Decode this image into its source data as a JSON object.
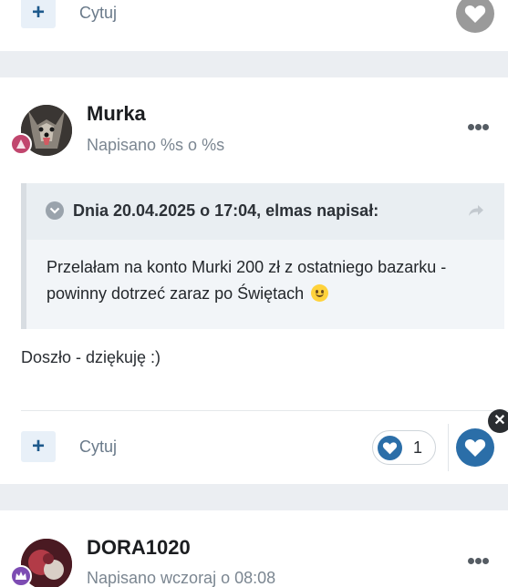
{
  "top_post": {
    "quote_label": "Cytuj"
  },
  "post": {
    "author": "Murka",
    "posted": "Napisano %s o %s",
    "quote": {
      "citation": "Dnia 20.04.2025 o 17:04, elmas napisał:",
      "text": "Przelałam na konto Murki 200 zł z ostatniego bazarku - powinny dotrzeć zaraz po Świętach"
    },
    "body": "Doszło - dziękuję :)",
    "quote_label": "Cytuj",
    "reaction_count": "1"
  },
  "next_post": {
    "author": "DORA1020",
    "posted": "Napisano wczoraj o 08:08"
  },
  "colors": {
    "accent": "#2b6ea8",
    "heart_inactive": "#9a9a9a",
    "background": "#ebeef2"
  }
}
